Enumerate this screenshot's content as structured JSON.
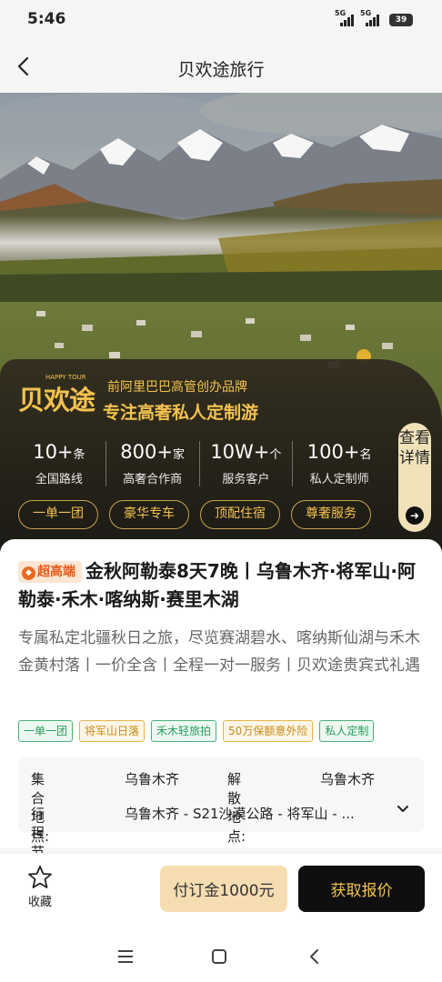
{
  "status_bar": {
    "time": "5:46",
    "signal1": "5G",
    "signal2": "5G",
    "battery": "39"
  },
  "nav": {
    "title": "贝欢途旅行"
  },
  "brand": {
    "logo_text": "贝欢途",
    "logo_small": "HAPPY TOUR",
    "tagline1": "前阿里巴巴高管创办品牌",
    "tagline2": "专注高奢私人定制游",
    "stats": [
      {
        "num": "10+",
        "unit": "条",
        "label": "全国路线"
      },
      {
        "num": "800+",
        "unit": "家",
        "label": "高奢合作商"
      },
      {
        "num": "10W+",
        "unit": "个",
        "label": "服务客户"
      },
      {
        "num": "100+",
        "unit": "名",
        "label": "私人定制师"
      }
    ],
    "pills": [
      "一单一团",
      "豪华专车",
      "顶配住宿",
      "尊奢服务"
    ],
    "detail_label": "查看详情"
  },
  "product": {
    "badge": "超高端",
    "title": "金秋阿勒泰8天7晚丨乌鲁木齐·将军山·阿勒泰·禾木·喀纳斯·赛里木湖",
    "description": "专属私定北疆秋日之旅，尽览赛湖碧水、喀纳斯仙湖与禾木金黄村落丨一价全含丨全程一对一服务丨贝欢途贵宾式礼遇",
    "tags": [
      {
        "label": "一单一团",
        "style": "green"
      },
      {
        "label": "将军山日落",
        "style": "gold"
      },
      {
        "label": "禾木轻旅拍",
        "style": "green"
      },
      {
        "label": "50万保额意外险",
        "style": "gold"
      },
      {
        "label": "私人定制",
        "style": "green"
      }
    ],
    "meeting_label": "集合地点:",
    "meeting_value": "乌鲁木齐",
    "dismiss_label": "解散地点:",
    "dismiss_value": "乌鲁木齐",
    "itinerary_label": "行程节奏:",
    "itinerary_value": "乌鲁木齐 - S21沙漠公路 - 将军山 - ..."
  },
  "actions": {
    "favorite": "收藏",
    "deposit": "付订金1000元",
    "quote": "获取报价"
  },
  "colors": {
    "gold": "#f3c24e",
    "dark": "#0f0f12",
    "deposit_bg": "#f6dcb1"
  }
}
